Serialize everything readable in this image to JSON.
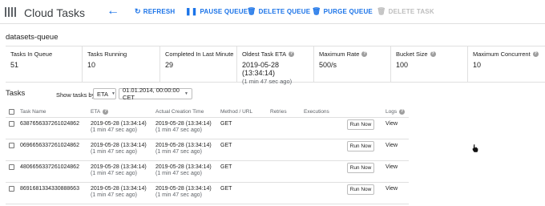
{
  "header": {
    "app_title": "Cloud Tasks",
    "back_icon": "arrow-left-icon",
    "actions": {
      "refresh": "REFRESH",
      "pause": "PAUSE QUEUE",
      "delete_queue": "DELETE QUEUE",
      "purge": "PURGE QUEUE",
      "delete_task": "DELETE TASK"
    },
    "accent_color": "#1a73e8",
    "disabled_color": "#bdbdbd"
  },
  "queue": {
    "name": "datasets-queue",
    "stats": [
      {
        "label": "Tasks In Queue",
        "value": "51",
        "sub": ""
      },
      {
        "label": "Tasks Running",
        "value": "10",
        "sub": ""
      },
      {
        "label": "Completed In Last Minute",
        "value": "29",
        "sub": ""
      },
      {
        "label": "Oldest Task ETA",
        "value": "2019-05-28 (13:34:14)",
        "sub": "(1 min 47 sec ago)"
      },
      {
        "label": "Maximum Rate",
        "value": "500/s",
        "sub": ""
      },
      {
        "label": "Bucket Size",
        "value": "100",
        "sub": ""
      },
      {
        "label": "Maximum Concurrent",
        "value": "10",
        "sub": ""
      }
    ]
  },
  "tasks": {
    "title": "Tasks",
    "show_by_label": "Show tasks by:",
    "show_by_value": "ETA",
    "date_value": "01.01.2014, 00:00:00 CET",
    "columns": {
      "task_name": "Task Name",
      "eta": "ETA",
      "creation": "Actual Creation Time",
      "method": "Method / URL",
      "retries": "Retries",
      "executions": "Executions",
      "logs": "Logs"
    },
    "run_now_label": "Run Now",
    "view_label": "View",
    "rows": [
      {
        "name": "6387656337261024862",
        "eta": "2019-05-28 (13:34:14)",
        "eta_ago": "(1 min 47 sec ago)",
        "created": "2019-05-28 (13:34:14)",
        "created_ago": "(1 min 47 sec ago)",
        "method": "GET"
      },
      {
        "name": "0696656337261024862",
        "eta": "2019-05-28 (13:34:14)",
        "eta_ago": "(1 min 47 sec ago)",
        "created": "2019-05-28 (13:34:14)",
        "created_ago": "(1 min 47 sec ago)",
        "method": "GET"
      },
      {
        "name": "4806656337261024862",
        "eta": "2019-05-28 (13:34:14)",
        "eta_ago": "(1 min 47 sec ago)",
        "created": "2019-05-28 (13:34:14)",
        "created_ago": "(1 min 47 sec ago)",
        "method": "GET"
      },
      {
        "name": "8691681334330888663",
        "eta": "2019-05-28 (13:34:14)",
        "eta_ago": "(1 min 47 sec ago)",
        "created": "2019-05-28 (13:34:14)",
        "created_ago": "(1 min 47 sec ago)",
        "method": "GET"
      }
    ]
  }
}
